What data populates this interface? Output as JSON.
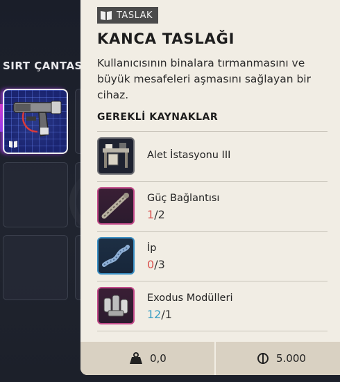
{
  "colors": {
    "card_bg": "#f1ede4",
    "footer_bg": "#d9d1c2",
    "tag_bg": "#4b4b4b",
    "qty_insufficient": "#d9534f",
    "qty_sufficient": "#3a9fc4",
    "inventory_bg": "#1b1f2b",
    "selected_slot_border": "#f1f1f1"
  },
  "inventory": {
    "title": "SIRT ÇANTASI",
    "slots": [
      {
        "item": "grapple-blueprint",
        "icon": "grapple-gun-icon",
        "badge": "blueprint-book-icon",
        "selected": true
      },
      {
        "item": null
      },
      {
        "item": null
      },
      {
        "item": null
      },
      {
        "item": null
      },
      {
        "item": null
      }
    ]
  },
  "tooltip": {
    "tag_icon": "blueprint-book-icon",
    "tag_label": "TASLAK",
    "title": "KANCA TASLAĞI",
    "description": "Kullanıcısının binalara tırmanmasını ve büyük mesafeleri aşmasını sağlayan bir cihaz.",
    "requirements_heading": "GEREKLİ KAYNAKLAR",
    "requirements": [
      {
        "name": "Alet İstasyonu III",
        "icon": "workbench-icon",
        "have": null,
        "need": null,
        "sufficient": null,
        "border": "#6f7075"
      },
      {
        "name": "Güç Bağlantısı",
        "icon": "power-cable-icon",
        "have": "1",
        "need": "/2",
        "sufficient": false,
        "border": "#c34a8a"
      },
      {
        "name": "İp",
        "icon": "rope-icon",
        "have": "0",
        "need": "/3",
        "sufficient": false,
        "border": "#3a8fc4"
      },
      {
        "name": "Exodus Modülleri",
        "icon": "exodus-modules-icon",
        "have": "12",
        "need": "/1",
        "sufficient": true,
        "border": "#c34a8a"
      }
    ]
  },
  "footer": {
    "weight_icon": "weight-icon",
    "weight": "0,0",
    "price_icon": "coin-icon",
    "price": "5.000"
  }
}
